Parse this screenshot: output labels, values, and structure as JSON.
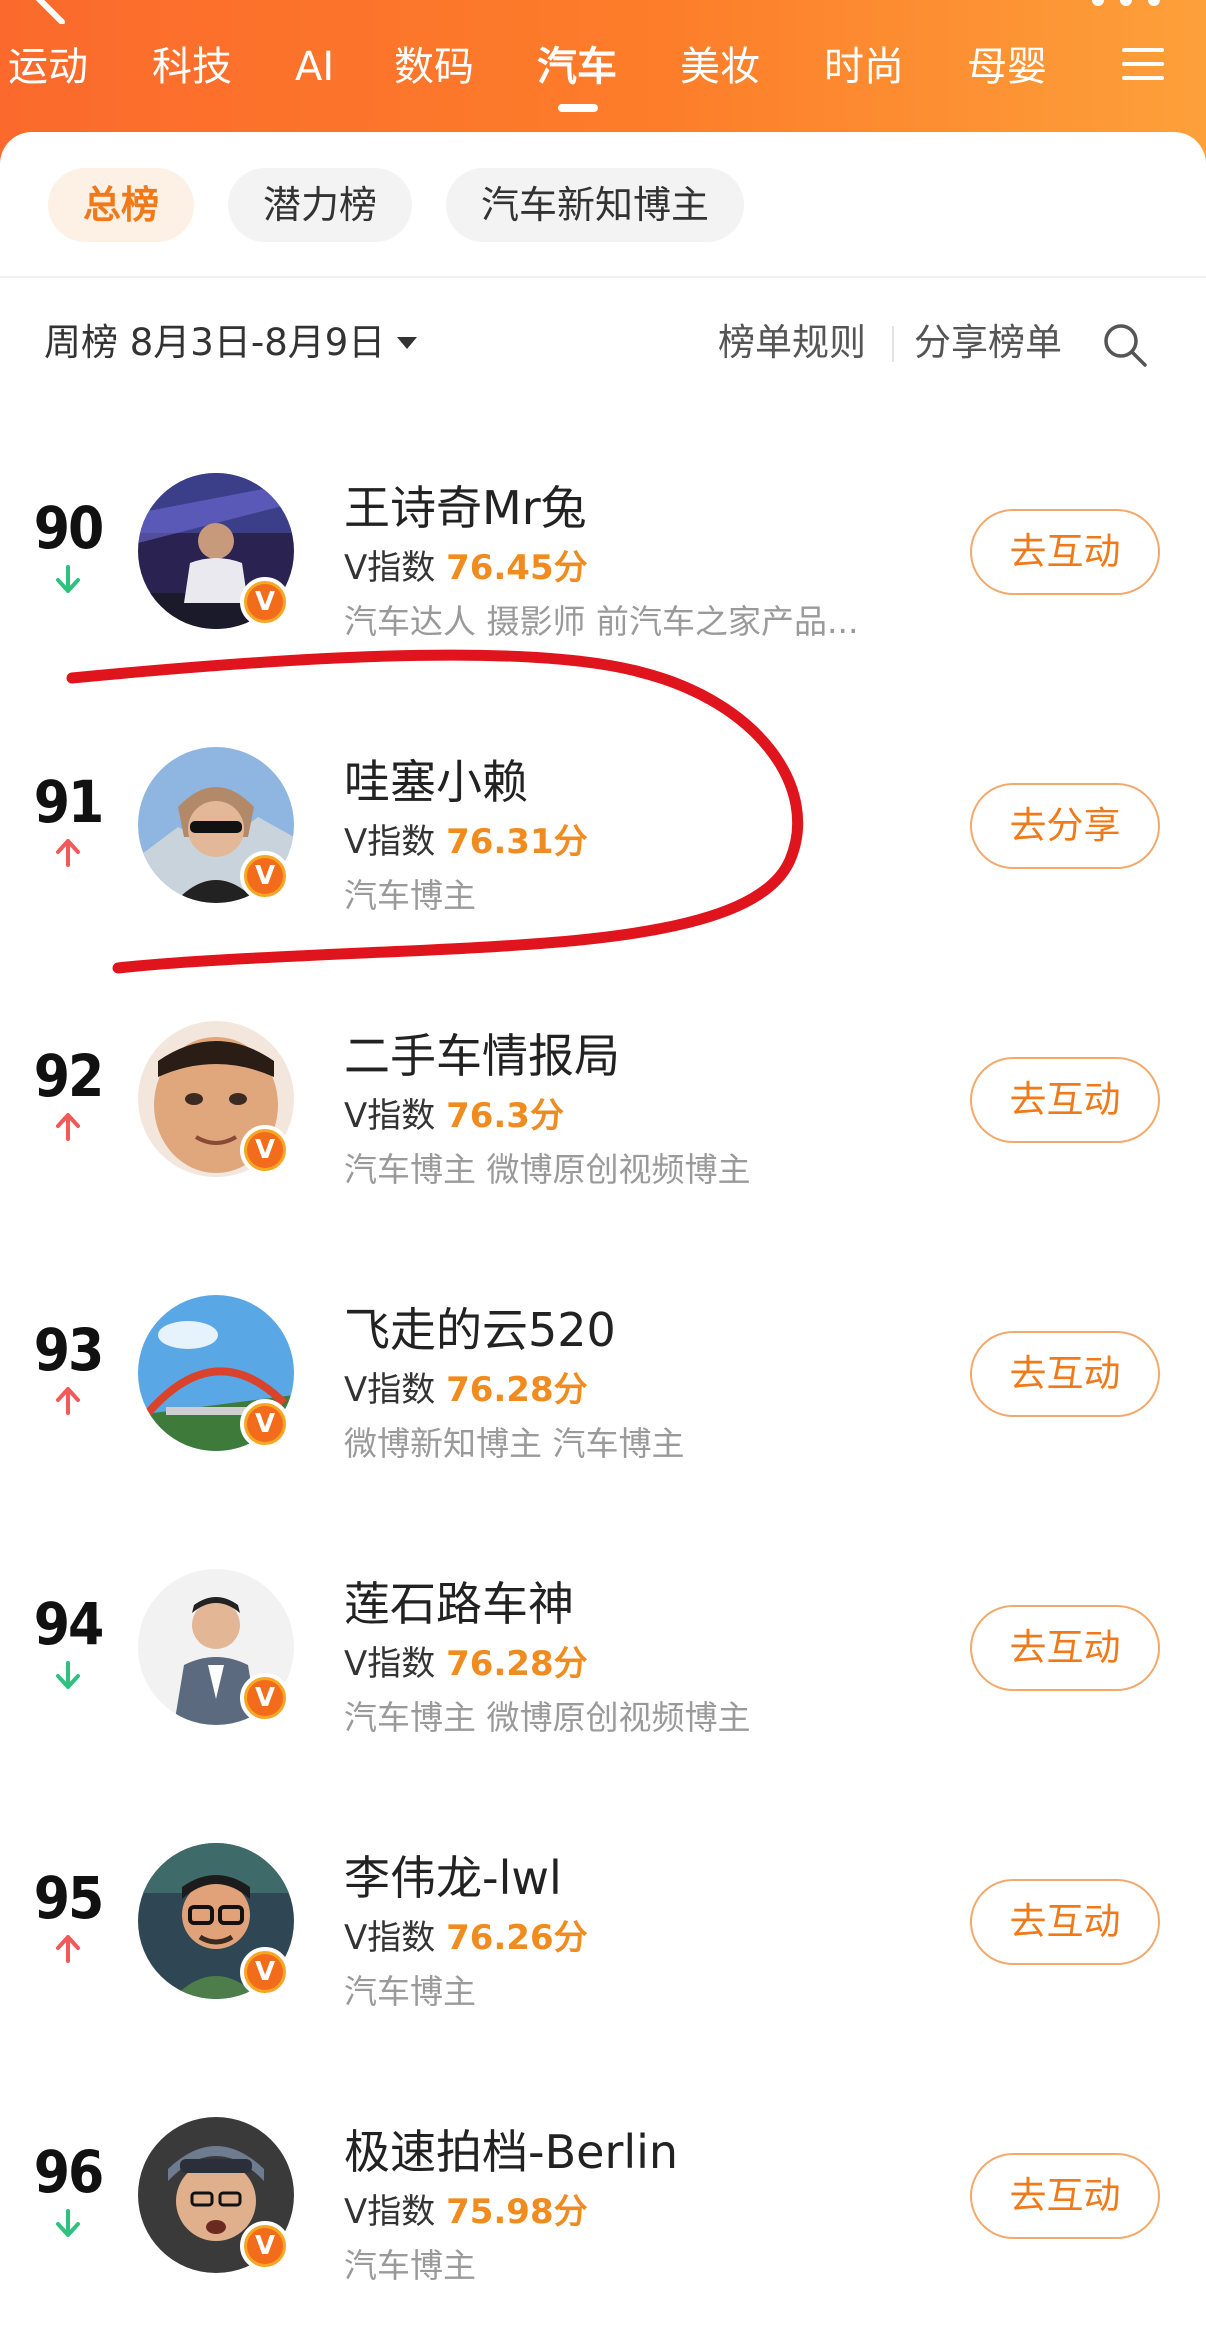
{
  "header": {
    "tabs": [
      {
        "label": "运动"
      },
      {
        "label": "科技"
      },
      {
        "label": "AI"
      },
      {
        "label": "数码"
      },
      {
        "label": "汽车"
      },
      {
        "label": "美妆"
      },
      {
        "label": "时尚"
      },
      {
        "label": "母婴"
      }
    ],
    "active_tab": "汽车"
  },
  "filters": {
    "chips": [
      {
        "label": "总榜"
      },
      {
        "label": "潜力榜"
      },
      {
        "label": "汽车新知博主"
      }
    ],
    "active": "总榜"
  },
  "toolbar": {
    "period": "周榜 8月3日-8月9日",
    "rules": "榜单规则",
    "share": "分享榜单"
  },
  "score_prefix": "V指数",
  "badge_glyph": "V",
  "colors": {
    "accent": "#f07a1a",
    "trend_up": "#f25a5a",
    "trend_down": "#2ec27e",
    "annotation": "#e0141c"
  },
  "rows": [
    {
      "rank": "90",
      "trend": "down",
      "name": "王诗奇Mr兔",
      "score": "76.45分",
      "desc": "汽车达人 摄影师 前汽车之家产品...",
      "button": "去互动"
    },
    {
      "rank": "91",
      "trend": "up",
      "name": "哇塞小赖",
      "score": "76.31分",
      "desc": "汽车博主",
      "button": "去分享"
    },
    {
      "rank": "92",
      "trend": "up",
      "name": "二手车情报局",
      "score": "76.3分",
      "desc": "汽车博主 微博原创视频博主",
      "button": "去互动"
    },
    {
      "rank": "93",
      "trend": "up",
      "name": "飞走的云520",
      "score": "76.28分",
      "desc": "微博新知博主 汽车博主",
      "button": "去互动"
    },
    {
      "rank": "94",
      "trend": "down",
      "name": "莲石路车神",
      "score": "76.28分",
      "desc": "汽车博主 微博原创视频博主",
      "button": "去互动"
    },
    {
      "rank": "95",
      "trend": "up",
      "name": "李伟龙-lwl",
      "score": "76.26分",
      "desc": "汽车博主",
      "button": "去互动"
    },
    {
      "rank": "96",
      "trend": "down",
      "name": "极速拍档-Berlin",
      "score": "75.98分",
      "desc": "汽车博主",
      "button": "去互动"
    }
  ]
}
